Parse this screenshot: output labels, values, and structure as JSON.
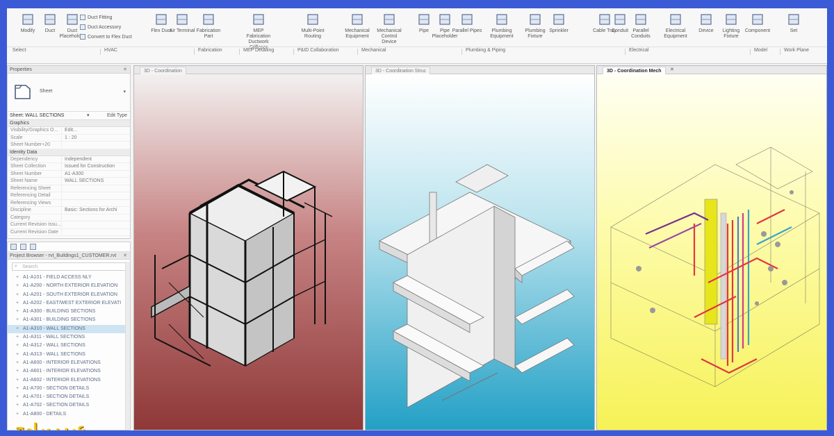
{
  "ribbon": {
    "buttons": [
      {
        "name": "modify-button",
        "label": "Modify",
        "icon": "cursor-icon"
      },
      {
        "name": "duct-button",
        "label": "Duct",
        "icon": "duct-icon"
      },
      {
        "name": "duct-placeholder-button",
        "label": "Duct Placeholder",
        "icon": "duct-placeholder-icon"
      },
      {
        "name": "flex-duct-button",
        "label": "Flex Duct",
        "icon": "flex-duct-icon"
      },
      {
        "name": "air-terminal-button",
        "label": "Air Terminal",
        "icon": "air-terminal-icon"
      },
      {
        "name": "fabrication-part-button",
        "label": "Fabrication Part",
        "icon": "fabrication-icon"
      },
      {
        "name": "mep-fabrication-ductwork-button",
        "label": "MEP Fabrication Ductwork Stiffener",
        "icon": "stiffener-icon"
      },
      {
        "name": "multi-point-routing-button",
        "label": "Multi-Point Routing",
        "icon": "routing-icon"
      },
      {
        "name": "mechanical-equipment-button",
        "label": "Mechanical Equipment",
        "icon": "mechanical-equipment-icon"
      },
      {
        "name": "mechanical-control-device-button",
        "label": "Mechanical Control Device",
        "icon": "control-device-icon"
      },
      {
        "name": "pipe-button",
        "label": "Pipe",
        "icon": "pipe-icon"
      },
      {
        "name": "pipe-placeholder-button",
        "label": "Pipe Placeholder",
        "icon": "pipe-placeholder-icon"
      },
      {
        "name": "parallel-pipes-button",
        "label": "Parallel Pipes",
        "icon": "parallel-pipes-icon"
      },
      {
        "name": "plumbing-equipment-button",
        "label": "Plumbing Equipment",
        "icon": "plumbing-equipment-icon"
      },
      {
        "name": "plumbing-fixture-button",
        "label": "Plumbing Fixture",
        "icon": "plumbing-fixture-icon"
      },
      {
        "name": "sprinkler-button",
        "label": "Sprinkler",
        "icon": "sprinkler-icon"
      },
      {
        "name": "cable-tray-button",
        "label": "Cable Tray",
        "icon": "cable-tray-icon"
      },
      {
        "name": "conduit-button",
        "label": "Conduit",
        "icon": "conduit-icon"
      },
      {
        "name": "parallel-conduits-button",
        "label": "Parallel Conduits",
        "icon": "parallel-conduits-icon"
      },
      {
        "name": "electrical-equipment-button",
        "label": "Electrical Equipment",
        "icon": "electrical-equipment-icon"
      },
      {
        "name": "device-button",
        "label": "Device",
        "icon": "device-icon"
      },
      {
        "name": "lighting-fixture-button",
        "label": "Lighting Fixture",
        "icon": "lighting-fixture-icon"
      },
      {
        "name": "component-button",
        "label": "Component",
        "icon": "component-icon"
      },
      {
        "name": "set-button",
        "label": "Set",
        "icon": "set-icon"
      }
    ],
    "small": [
      {
        "name": "duct-fitting-button",
        "label": "Duct Fitting"
      },
      {
        "name": "duct-accessory-button",
        "label": "Duct Accessory"
      },
      {
        "name": "convert-to-flex-duct-button",
        "label": "Convert to Flex Duct"
      }
    ],
    "groups": [
      "Select",
      "HVAC",
      "Fabrication",
      "MEP Detailing",
      "P&ID Collaboration",
      "Mechanical",
      "Plumbing & Piping",
      "Electrical",
      "Model",
      "Work Plane"
    ]
  },
  "properties": {
    "title": "Properties",
    "type_name": "Sheet",
    "instance": "Sheet: WALL SECTIONS",
    "edit_type": "Edit Type",
    "sections": [
      {
        "title": "Graphics",
        "rows": [
          [
            "Visibility/Graphics O...",
            "Edit..."
          ],
          [
            "Scale",
            "1 : 20"
          ],
          [
            "Sheet Number+20",
            ""
          ]
        ]
      },
      {
        "title": "Identity Data",
        "rows": [
          [
            "Dependency",
            "Independent"
          ],
          [
            "Sheet Collection",
            "Issued for Construction"
          ],
          [
            "Sheet Number",
            "A1-A300"
          ],
          [
            "Sheet Name",
            "WALL SECTIONS"
          ],
          [
            "Referencing Sheet",
            ""
          ],
          [
            "Referencing Detail",
            ""
          ],
          [
            "Referencing Views",
            ""
          ],
          [
            "Discipline",
            "Basic: Sections for Archi"
          ],
          [
            "Category",
            ""
          ],
          [
            "Current Revision Issu...",
            ""
          ],
          [
            "Current Revision Date",
            ""
          ]
        ]
      }
    ]
  },
  "browser": {
    "title": "Project Browser - rvt_Buildings1_CUSTOMER.rvt",
    "search_placeholder": "Search",
    "items": [
      "A1-A101 - FIELD ACCESS NLY",
      "A1-A200 - NORTH EXTERIOR ELEVATION",
      "A1-A201 - SOUTH EXTERIOR ELEVATION",
      "A1-A202 - EAST/WEST EXTERIOR ELEVATI",
      "A1-A300 - BUILDING SECTIONS",
      "A1-A301 - BUILDING SECTIONS",
      "A1-A310 - WALL SECTIONS",
      "A1-A311 - WALL SECTIONS",
      "A1-A312 - WALL SECTIONS",
      "A1-A313 - WALL SECTIONS",
      "A1-A600 - INTERIOR ELEVATIONS",
      "A1-A601 - INTERIOR ELEVATIONS",
      "A1-A602 - INTERIOR ELEVATIONS",
      "A1-A700 - SECTION DETAILS",
      "A1-A701 - SECTION DETAILS",
      "A1-A702 - SECTION DETAILS",
      "A1-A800 - DETAILS"
    ],
    "selected_index": 6
  },
  "views": [
    {
      "name": "3D - Coordination",
      "active": false
    },
    {
      "name": "3D - Coordination Struc",
      "active": false
    },
    {
      "name": "3D - Coordination Mech",
      "active": true
    }
  ],
  "watermark": "عرب برامج"
}
